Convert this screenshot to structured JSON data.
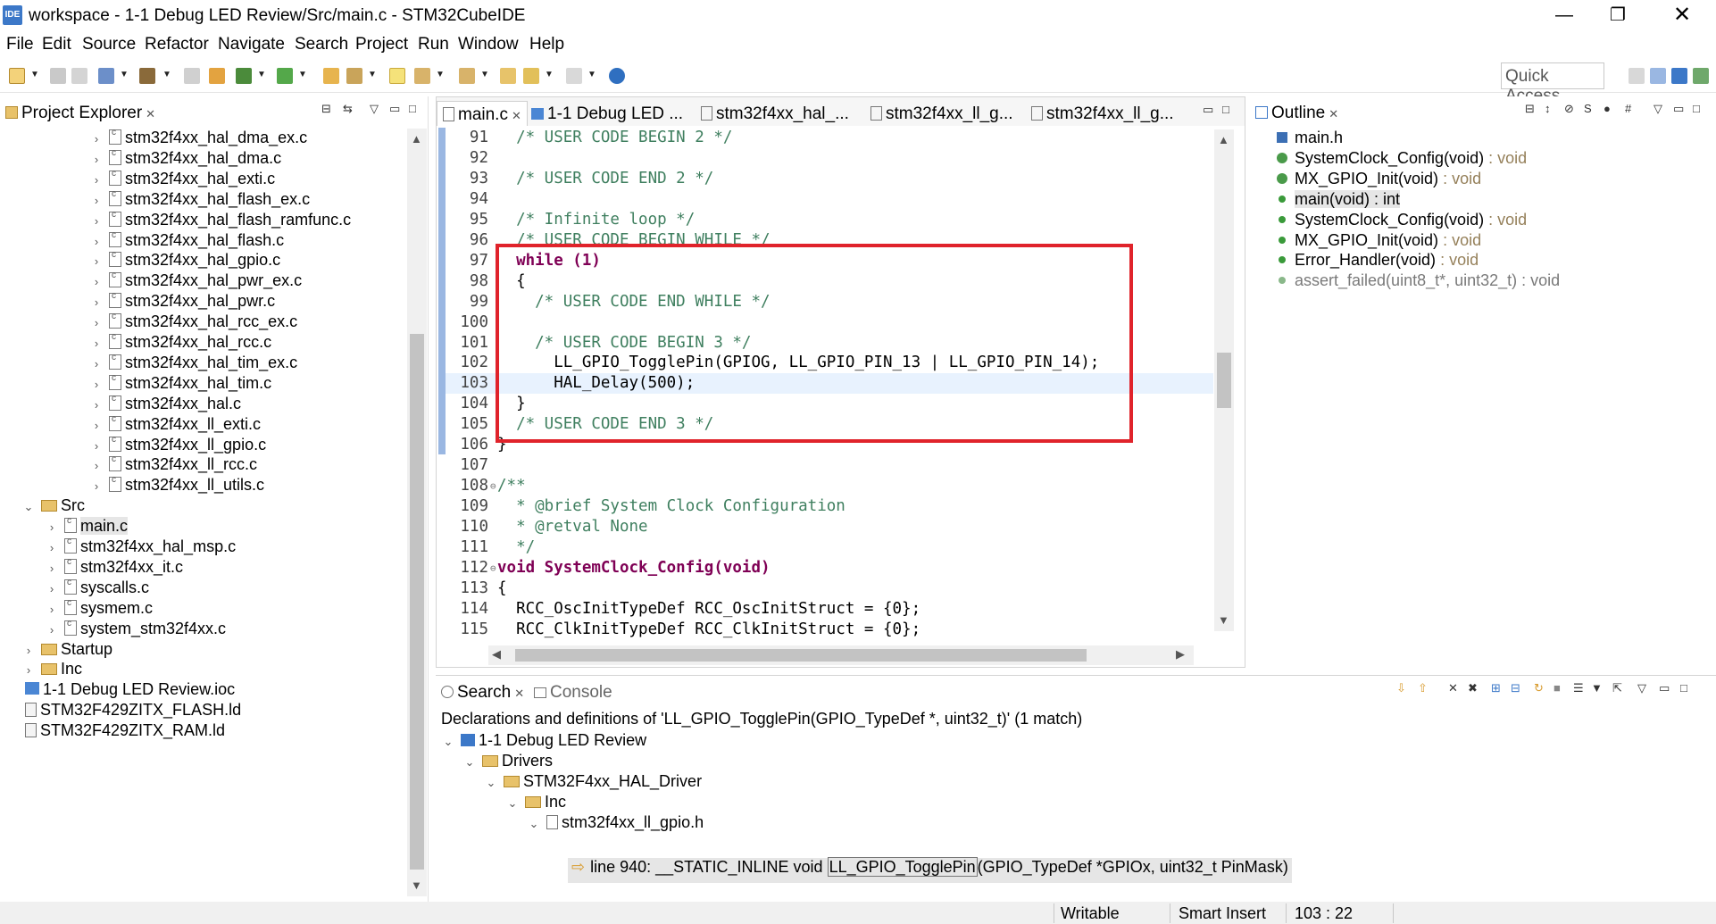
{
  "window": {
    "logo": "IDE",
    "title": "workspace - 1-1 Debug LED Review/Src/main.c - STM32CubeIDE",
    "minimize": "—",
    "maximize": "❐",
    "close": "✕"
  },
  "menu": [
    "File",
    "Edit",
    "Source",
    "Refactor",
    "Navigate",
    "Search",
    "Project",
    "Run",
    "Window",
    "Help"
  ],
  "toolbar": {
    "quick_access": "Quick Access"
  },
  "project_explorer": {
    "title": "Project Explorer",
    "items": [
      {
        "label": "stm32f4xx_hal_dma_ex.c",
        "kind": "file",
        "depth": 3,
        "expanded": false
      },
      {
        "label": "stm32f4xx_hal_dma.c",
        "kind": "file",
        "depth": 3,
        "expanded": false
      },
      {
        "label": "stm32f4xx_hal_exti.c",
        "kind": "file",
        "depth": 3,
        "expanded": false
      },
      {
        "label": "stm32f4xx_hal_flash_ex.c",
        "kind": "file",
        "depth": 3,
        "expanded": false
      },
      {
        "label": "stm32f4xx_hal_flash_ramfunc.c",
        "kind": "file",
        "depth": 3,
        "expanded": false
      },
      {
        "label": "stm32f4xx_hal_flash.c",
        "kind": "file",
        "depth": 3,
        "expanded": false
      },
      {
        "label": "stm32f4xx_hal_gpio.c",
        "kind": "file",
        "depth": 3,
        "expanded": false
      },
      {
        "label": "stm32f4xx_hal_pwr_ex.c",
        "kind": "file",
        "depth": 3,
        "expanded": false
      },
      {
        "label": "stm32f4xx_hal_pwr.c",
        "kind": "file",
        "depth": 3,
        "expanded": false
      },
      {
        "label": "stm32f4xx_hal_rcc_ex.c",
        "kind": "file",
        "depth": 3,
        "expanded": false
      },
      {
        "label": "stm32f4xx_hal_rcc.c",
        "kind": "file",
        "depth": 3,
        "expanded": false
      },
      {
        "label": "stm32f4xx_hal_tim_ex.c",
        "kind": "file",
        "depth": 3,
        "expanded": false
      },
      {
        "label": "stm32f4xx_hal_tim.c",
        "kind": "file",
        "depth": 3,
        "expanded": false
      },
      {
        "label": "stm32f4xx_hal.c",
        "kind": "file",
        "depth": 3,
        "expanded": false
      },
      {
        "label": "stm32f4xx_ll_exti.c",
        "kind": "file",
        "depth": 3,
        "expanded": false
      },
      {
        "label": "stm32f4xx_ll_gpio.c",
        "kind": "file",
        "depth": 3,
        "expanded": false
      },
      {
        "label": "stm32f4xx_ll_rcc.c",
        "kind": "file",
        "depth": 3,
        "expanded": false
      },
      {
        "label": "stm32f4xx_ll_utils.c",
        "kind": "file",
        "depth": 3,
        "expanded": false
      },
      {
        "label": "Src",
        "kind": "folder",
        "depth": 1,
        "expanded": true
      },
      {
        "label": "main.c",
        "kind": "file",
        "depth": 2,
        "expanded": false,
        "selected": true
      },
      {
        "label": "stm32f4xx_hal_msp.c",
        "kind": "file",
        "depth": 2,
        "expanded": false
      },
      {
        "label": "stm32f4xx_it.c",
        "kind": "file",
        "depth": 2,
        "expanded": false
      },
      {
        "label": "syscalls.c",
        "kind": "file",
        "depth": 2,
        "expanded": false
      },
      {
        "label": "sysmem.c",
        "kind": "file",
        "depth": 2,
        "expanded": false
      },
      {
        "label": "system_stm32f4xx.c",
        "kind": "file",
        "depth": 2,
        "expanded": false
      },
      {
        "label": "Startup",
        "kind": "folder",
        "depth": 1,
        "expanded": false
      },
      {
        "label": "Inc",
        "kind": "folder",
        "depth": 1,
        "expanded": false
      },
      {
        "label": "1-1 Debug LED Review.ioc",
        "kind": "ioc",
        "depth": 1
      },
      {
        "label": "STM32F429ZITX_FLASH.ld",
        "kind": "ld",
        "depth": 1
      },
      {
        "label": "STM32F429ZITX_RAM.ld",
        "kind": "ld",
        "depth": 1
      }
    ]
  },
  "editor": {
    "tabs": [
      "main.c",
      "1-1 Debug LED ...",
      "stm32f4xx_hal_...",
      "stm32f4xx_ll_g...",
      "stm32f4xx_ll_g..."
    ],
    "active_tab": 0,
    "lines": [
      {
        "n": "91",
        "text": "  /* USER CODE BEGIN 2 */"
      },
      {
        "n": "92",
        "text": ""
      },
      {
        "n": "93",
        "text": "  /* USER CODE END 2 */"
      },
      {
        "n": "94",
        "text": ""
      },
      {
        "n": "95",
        "text": "  /* Infinite loop */"
      },
      {
        "n": "96",
        "text": "  /* USER CODE BEGIN WHILE */"
      },
      {
        "n": "97",
        "text": "  while (1)"
      },
      {
        "n": "98",
        "text": "  {"
      },
      {
        "n": "99",
        "text": "    /* USER CODE END WHILE */"
      },
      {
        "n": "100",
        "text": ""
      },
      {
        "n": "101",
        "text": "    /* USER CODE BEGIN 3 */"
      },
      {
        "n": "102",
        "text": "      LL_GPIO_TogglePin(GPIOG, LL_GPIO_PIN_13 | LL_GPIO_PIN_14);"
      },
      {
        "n": "103",
        "text": "      HAL_Delay(500);"
      },
      {
        "n": "104",
        "text": "  }"
      },
      {
        "n": "105",
        "text": "  /* USER CODE END 3 */"
      },
      {
        "n": "106",
        "text": "}"
      },
      {
        "n": "107",
        "text": ""
      },
      {
        "n": "108",
        "text": "/**",
        "fold": true
      },
      {
        "n": "109",
        "text": "  * @brief System Clock Configuration"
      },
      {
        "n": "110",
        "text": "  * @retval None"
      },
      {
        "n": "111",
        "text": "  */"
      },
      {
        "n": "112",
        "text": "void SystemClock_Config(void)",
        "fold": true
      },
      {
        "n": "113",
        "text": "{"
      },
      {
        "n": "114",
        "text": "  RCC_OscInitTypeDef RCC_OscInitStruct = {0};"
      },
      {
        "n": "115",
        "text": "  RCC_ClkInitTypeDef RCC_ClkInitStruct = {0};"
      }
    ],
    "current_line": "103"
  },
  "outline": {
    "title": "Outline",
    "items": [
      {
        "label": "main.h",
        "type": "",
        "icon": "include-icon"
      },
      {
        "label": "SystemClock_Config(void)",
        "type": " : void",
        "icon": "declaration-icon"
      },
      {
        "label": "MX_GPIO_Init(void)",
        "type": " : void",
        "icon": "static-declaration-icon"
      },
      {
        "label": "main(void) : int",
        "type": "",
        "icon": "function-icon",
        "selected": true
      },
      {
        "label": "SystemClock_Config(void)",
        "type": " : void",
        "icon": "function-icon"
      },
      {
        "label": "MX_GPIO_Init(void)",
        "type": " : void",
        "icon": "static-function-icon"
      },
      {
        "label": "Error_Handler(void)",
        "type": " : void",
        "icon": "function-icon"
      },
      {
        "label": "assert_failed(uint8_t*, uint32_t) : void",
        "type": "",
        "icon": "disabled-function-icon",
        "dim": true
      }
    ]
  },
  "search": {
    "tabs": [
      "Search",
      "Console"
    ],
    "summary": "Declarations and definitions of 'LL_GPIO_TogglePin(GPIO_TypeDef *, uint32_t)' (1 match)",
    "tree": [
      {
        "label": "1-1 Debug LED Review",
        "kind": "project",
        "indent": 0
      },
      {
        "label": "Drivers",
        "kind": "folder",
        "indent": 1
      },
      {
        "label": "STM32F4xx_HAL_Driver",
        "kind": "folder",
        "indent": 2
      },
      {
        "label": "Inc",
        "kind": "folder",
        "indent": 3
      },
      {
        "label": "stm32f4xx_ll_gpio.h",
        "kind": "header",
        "indent": 4
      }
    ],
    "match": {
      "prefix": "line 940:  __STATIC_INLINE void ",
      "word": "LL_GPIO_TogglePin",
      "suffix": "(GPIO_TypeDef *GPIOx, uint32_t PinMask)"
    }
  },
  "status": {
    "writable": "Writable",
    "insert_mode": "Smart Insert",
    "position": "103 : 22"
  },
  "colors": {
    "comment": "#3f7f5f",
    "keyword": "#7f0055",
    "highlight_box": "#e0232b",
    "outline_type": "#95805a"
  }
}
